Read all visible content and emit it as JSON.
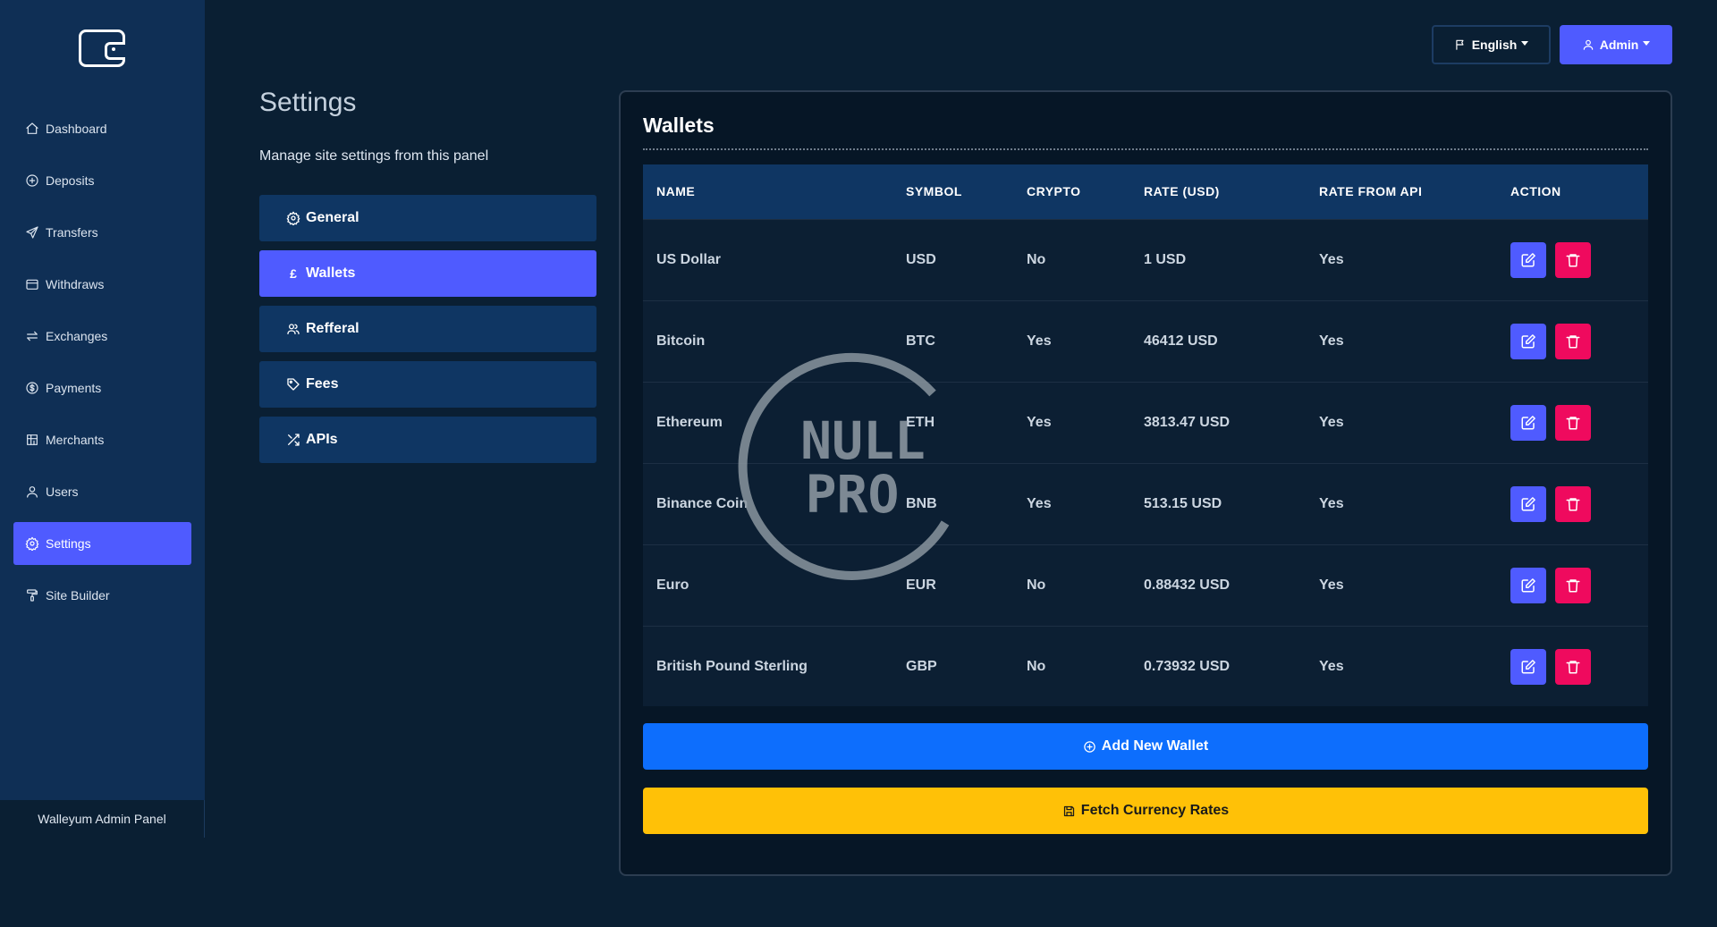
{
  "sidebar": {
    "items": [
      {
        "label": "Dashboard",
        "icon": "home-icon"
      },
      {
        "label": "Deposits",
        "icon": "plus-circle-icon"
      },
      {
        "label": "Transfers",
        "icon": "send-icon"
      },
      {
        "label": "Withdraws",
        "icon": "wallet-icon"
      },
      {
        "label": "Exchanges",
        "icon": "arrows-exchange-icon"
      },
      {
        "label": "Payments",
        "icon": "dollar-circle-icon"
      },
      {
        "label": "Merchants",
        "icon": "store-icon"
      },
      {
        "label": "Users",
        "icon": "user-icon"
      },
      {
        "label": "Settings",
        "icon": "gear-icon"
      },
      {
        "label": "Site Builder",
        "icon": "paint-roller-icon"
      }
    ],
    "active": "Settings",
    "footer": "Walleyum Admin Panel"
  },
  "topbar": {
    "language_label": "English",
    "user_label": "Admin"
  },
  "settings": {
    "title": "Settings",
    "subtitle": "Manage site settings from this panel",
    "tabs": [
      {
        "label": "General",
        "icon": "gear-icon"
      },
      {
        "label": "Wallets",
        "icon": "pound-icon",
        "glyph": "£"
      },
      {
        "label": "Refferal",
        "icon": "users-icon"
      },
      {
        "label": "Fees",
        "icon": "tag-icon"
      },
      {
        "label": "APIs",
        "icon": "shuffle-icon"
      }
    ],
    "active_tab": "Wallets"
  },
  "wallets": {
    "title": "Wallets",
    "columns": [
      "NAME",
      "SYMBOL",
      "CRYPTO",
      "RATE (USD)",
      "RATE FROM API",
      "ACTION"
    ],
    "rows": [
      {
        "name": "US Dollar",
        "symbol": "USD",
        "crypto": "No",
        "rate": "1 USD",
        "rate_from_api": "Yes"
      },
      {
        "name": "Bitcoin",
        "symbol": "BTC",
        "crypto": "Yes",
        "rate": "46412 USD",
        "rate_from_api": "Yes"
      },
      {
        "name": "Ethereum",
        "symbol": "ETH",
        "crypto": "Yes",
        "rate": "3813.47 USD",
        "rate_from_api": "Yes"
      },
      {
        "name": "Binance Coin",
        "symbol": "BNB",
        "crypto": "Yes",
        "rate": "513.15 USD",
        "rate_from_api": "Yes"
      },
      {
        "name": "Euro",
        "symbol": "EUR",
        "crypto": "No",
        "rate": "0.88432 USD",
        "rate_from_api": "Yes"
      },
      {
        "name": "British Pound Sterling",
        "symbol": "GBP",
        "crypto": "No",
        "rate": "0.73932 USD",
        "rate_from_api": "Yes"
      }
    ],
    "add_label": "Add New Wallet",
    "fetch_label": "Fetch Currency Rates"
  },
  "watermark": {
    "line1": "NULL",
    "line2": "PRO"
  },
  "colors": {
    "accent": "#4f5bff",
    "primary": "#0d6efd",
    "warning": "#ffc107",
    "danger": "#ef0a5e",
    "sidebar_bg": "#0f2f55",
    "page_bg": "#0a1f33"
  }
}
